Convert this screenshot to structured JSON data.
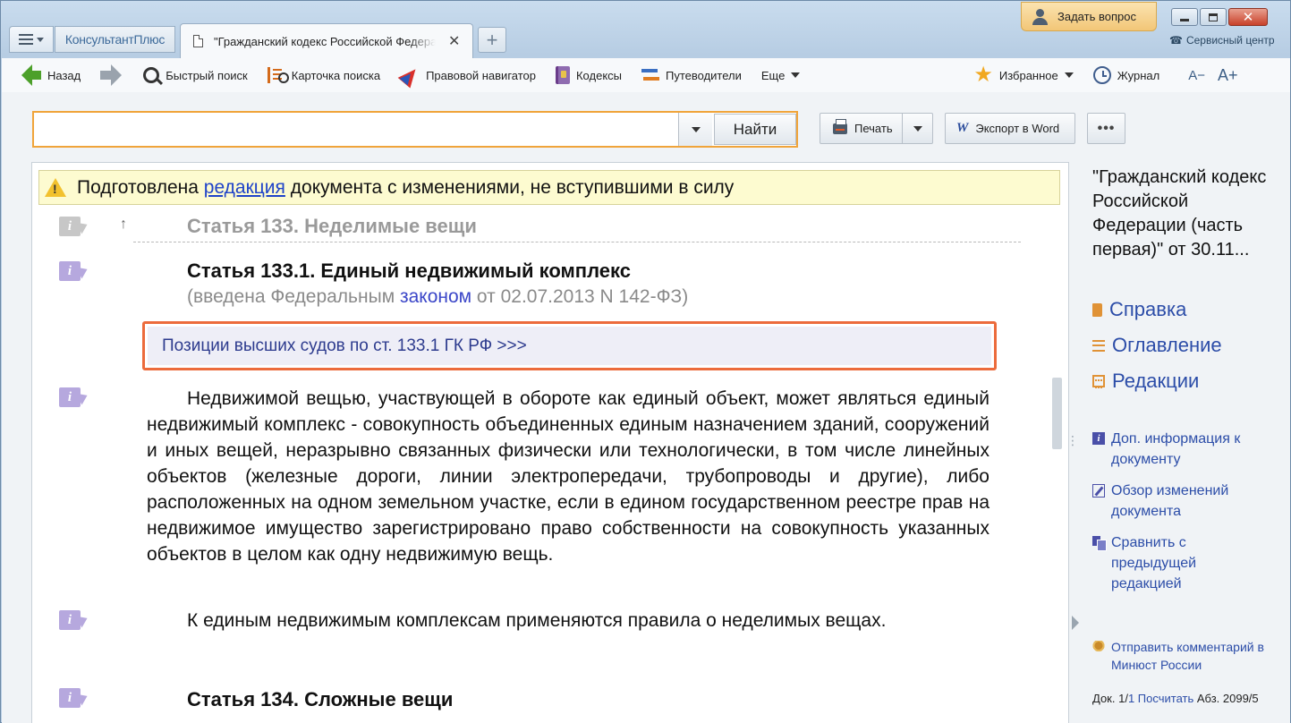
{
  "tabs": {
    "brand": "КонсультантПлюс",
    "active_doc_tab": "\"Гражданский кодекс Российской Федерации\"",
    "close": "✕"
  },
  "header": {
    "ask_question": "Задать вопрос",
    "service_center": "Сервисный центр"
  },
  "toolbar": {
    "back": "Назад",
    "quick_search": "Быстрый поиск",
    "search_card": "Карточка поиска",
    "legal_navigator": "Правовой навигатор",
    "codes": "Кодексы",
    "guides": "Путеводители",
    "more": "Еще",
    "favorites": "Избранное",
    "journal": "Журнал",
    "font_smaller": "A−",
    "font_larger": "A+"
  },
  "search": {
    "value": "",
    "find_button": "Найти"
  },
  "actions": {
    "print": "Печать",
    "export_word": "Экспорт в Word",
    "more": "•••"
  },
  "document": {
    "warning_prefix": "Подготовлена ",
    "warning_link": "редакция",
    "warning_suffix": " документа с изменениями, не вступившими в силу",
    "prev_article": "Статья 133. Неделимые вещи",
    "article_title": "Статья 133.1. Единый недвижимый комплекс",
    "intro_prefix": "(введена Федеральным ",
    "intro_link": "законом",
    "intro_suffix": " от 02.07.2013 N 142-ФЗ)",
    "court_positions": "Позиции высших судов по ст. 133.1 ГК РФ >>>",
    "paragraph1": "Недвижимой вещью, участвующей в обороте как единый объект, может являться единый недвижимый комплекс - совокупность объединенных единым назначением зданий, сооружений и иных вещей, неразрывно связанных физически или технологически, в том числе линейных объектов (железные дороги, линии электропередачи, трубопроводы и другие), либо расположенных на одном земельном участке, если в едином государственном реестре прав на недвижимое имущество зарегистрировано право собственности на совокупность указанных объектов в целом как одну недвижимую вещь.",
    "paragraph2": "К единым недвижимым комплексам применяются правила о неделимых вещах.",
    "next_article": "Статья 134. Сложные вещи"
  },
  "sidebar": {
    "doc_title": "\"Гражданский кодекс Российской Федерации (часть первая)\" от 30.11...",
    "links": [
      "Справка",
      "Оглавление",
      "Редакции"
    ],
    "extra_info": "Доп. информация к документу",
    "changes_review": "Обзор изменений документа",
    "compare_prev": "Сравнить с предыдущей редакцией",
    "send_comment": "Отправить комментарий в Минюст России",
    "status_prefix": "Док. 1/",
    "status_doc_link": "1",
    "status_count_link": "Посчитать",
    "status_suffix": " Абз. 2099/5"
  },
  "colors": {
    "accent_orange": "#ec6b3c",
    "link_blue": "#2c4da8",
    "warning_bg": "#fdfbd0"
  }
}
